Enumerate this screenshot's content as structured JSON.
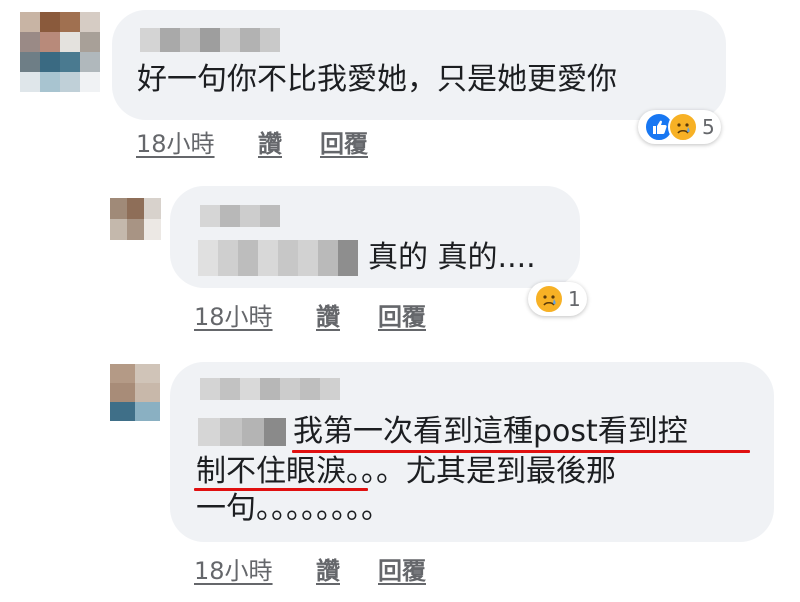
{
  "comments": [
    {
      "text_lines": [
        "好一句你不比我愛她，只是她更愛你"
      ],
      "actions": {
        "time": "18小時",
        "like": "讚",
        "reply": "回覆"
      },
      "reactions": {
        "icons": [
          "like-icon",
          "sad-icon"
        ],
        "count": "5"
      }
    },
    {
      "text_lines": [
        "真的 真的...."
      ],
      "actions": {
        "time": "18小時",
        "like": "讚",
        "reply": "回覆"
      },
      "reactions": {
        "icons": [
          "sad-icon"
        ],
        "count": "1"
      }
    },
    {
      "text_lines": [
        "我第一次看到這種post看到控",
        "制不住眼淚。。。尤其是到最後那",
        "一句。。。。。。。。"
      ],
      "actions": {
        "time": "18小時",
        "like": "讚",
        "reply": "回覆"
      },
      "highlight_color": "#e01010"
    }
  ],
  "colors": {
    "bubble": "#f0f2f5",
    "meta_text": "#65676b",
    "like_blue": "#1877f2",
    "sad_yellow": "#f7b125"
  }
}
